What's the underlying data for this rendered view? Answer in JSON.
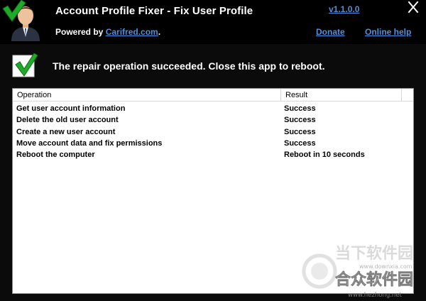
{
  "header": {
    "title": "Account Profile Fixer - Fix User Profile",
    "powered_prefix": "Powered by ",
    "powered_link": "Carifred.com",
    "powered_suffix": ".",
    "version": "v1.1.0.0",
    "donate": "Donate",
    "online_help": "Online help"
  },
  "status": {
    "message": "The repair operation succeeded. Close this app to reboot."
  },
  "table": {
    "columns": [
      "Operation",
      "Result"
    ],
    "rows": [
      {
        "operation": "Get user account information",
        "result": "Success"
      },
      {
        "operation": "Delete the old user account",
        "result": "Success"
      },
      {
        "operation": "Create a new user account",
        "result": "Success"
      },
      {
        "operation": "Move account data and fix permissions",
        "result": "Success"
      },
      {
        "operation": "Reboot the computer",
        "result": "Reboot in 10 seconds"
      }
    ]
  },
  "watermark": {
    "line1": "当下软件园",
    "line2": "www.downxia.com",
    "line3": "合众软件园",
    "line4": "www.hezhong.net"
  },
  "colors": {
    "link": "#4f8fe0",
    "check_green": "#1faa2a",
    "background": "#0b0b0b"
  }
}
